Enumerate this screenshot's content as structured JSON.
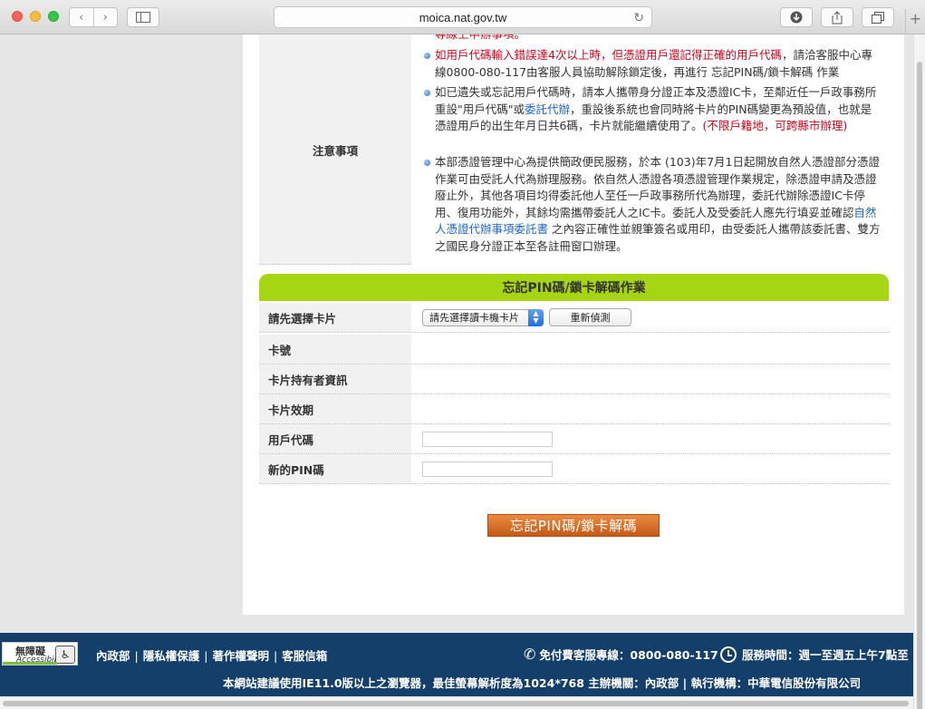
{
  "browser": {
    "url": "moica.nat.gov.tw",
    "back_glyph": "‹",
    "forward_glyph": "›",
    "newtab_glyph": "+"
  },
  "notice": {
    "label": "注意事項",
    "clipped_line": "專線上申辦事項。",
    "item1_red": "如用戶代碼輸入錯誤達4次以上時，但憑證用戶還記得正確的用戶代碼",
    "item1_rest": "，請洽客服中心專線0800-080-117由客服人員協助解除鎖定後，再進行 忘記PIN碼/鎖卡解碼 作業",
    "item2_a": "如已遺失或忘記用戶代碼時，請本人攜帶身分證正本及憑證IC卡，至鄰近任一戶政事務所重設\"用戶代碼\"或",
    "item2_link": "委託代辦",
    "item2_b": "，重設後系統也會同時將卡片的PIN碼變更為預設值，也就是憑證用戶的出生年月日共6碼，卡片就能繼續使用了。",
    "item2_red": "(不限戶籍地，可跨縣市辦理)",
    "item3_a": "本部憑證管理中心為提供簡政便民服務，於本 (103)年7月1日起開放自然人憑證部分憑證作業可由受託人代為辦理服務。依自然人憑證各項憑證管理作業規定，除憑證申請及憑證廢止外，其他各項目均得委託他人至任一戶政事務所代為辦理，委託代辦除憑證IC卡停用、復用功能外，其餘均需攜帶委託人之IC卡。委託人及受委託人應先行填妥並確認",
    "item3_link": "自然人憑證代辦事項委託書",
    "item3_b": " 之內容正確性並親筆簽名或用印，由受委託人攜帶該委託書、雙方之國民身分證正本至各註冊窗口辦理。"
  },
  "form": {
    "title": "忘記PIN碼/鎖卡解碼作業",
    "rows": {
      "select_card": "請先選擇卡片",
      "card_no": "卡號",
      "holder": "卡片持有者資訊",
      "expiry": "卡片效期",
      "user_code": "用戶代碼",
      "new_pin": "新的PIN碼"
    },
    "reader_select": "請先選擇讀卡機卡片",
    "redetect_button": "重新偵測",
    "submit_button": "忘記PIN碼/鎖卡解碼"
  },
  "footer": {
    "accessibility_title": "無障礙",
    "accessibility_sub": "Accessibility",
    "links": [
      "內政部",
      "隱私權保護",
      "著作權聲明",
      "客服信箱"
    ],
    "hotline": "免付費客服專線：0800-080-117",
    "service_hours": "服務時間：週一至週五上午7點至",
    "info": "本網站建議使用IE11.0版以上之瀏覽器，最佳螢幕解析度為1024*768 主辦機關：內政部 | 執行機構：中華電信股份有限公司"
  }
}
